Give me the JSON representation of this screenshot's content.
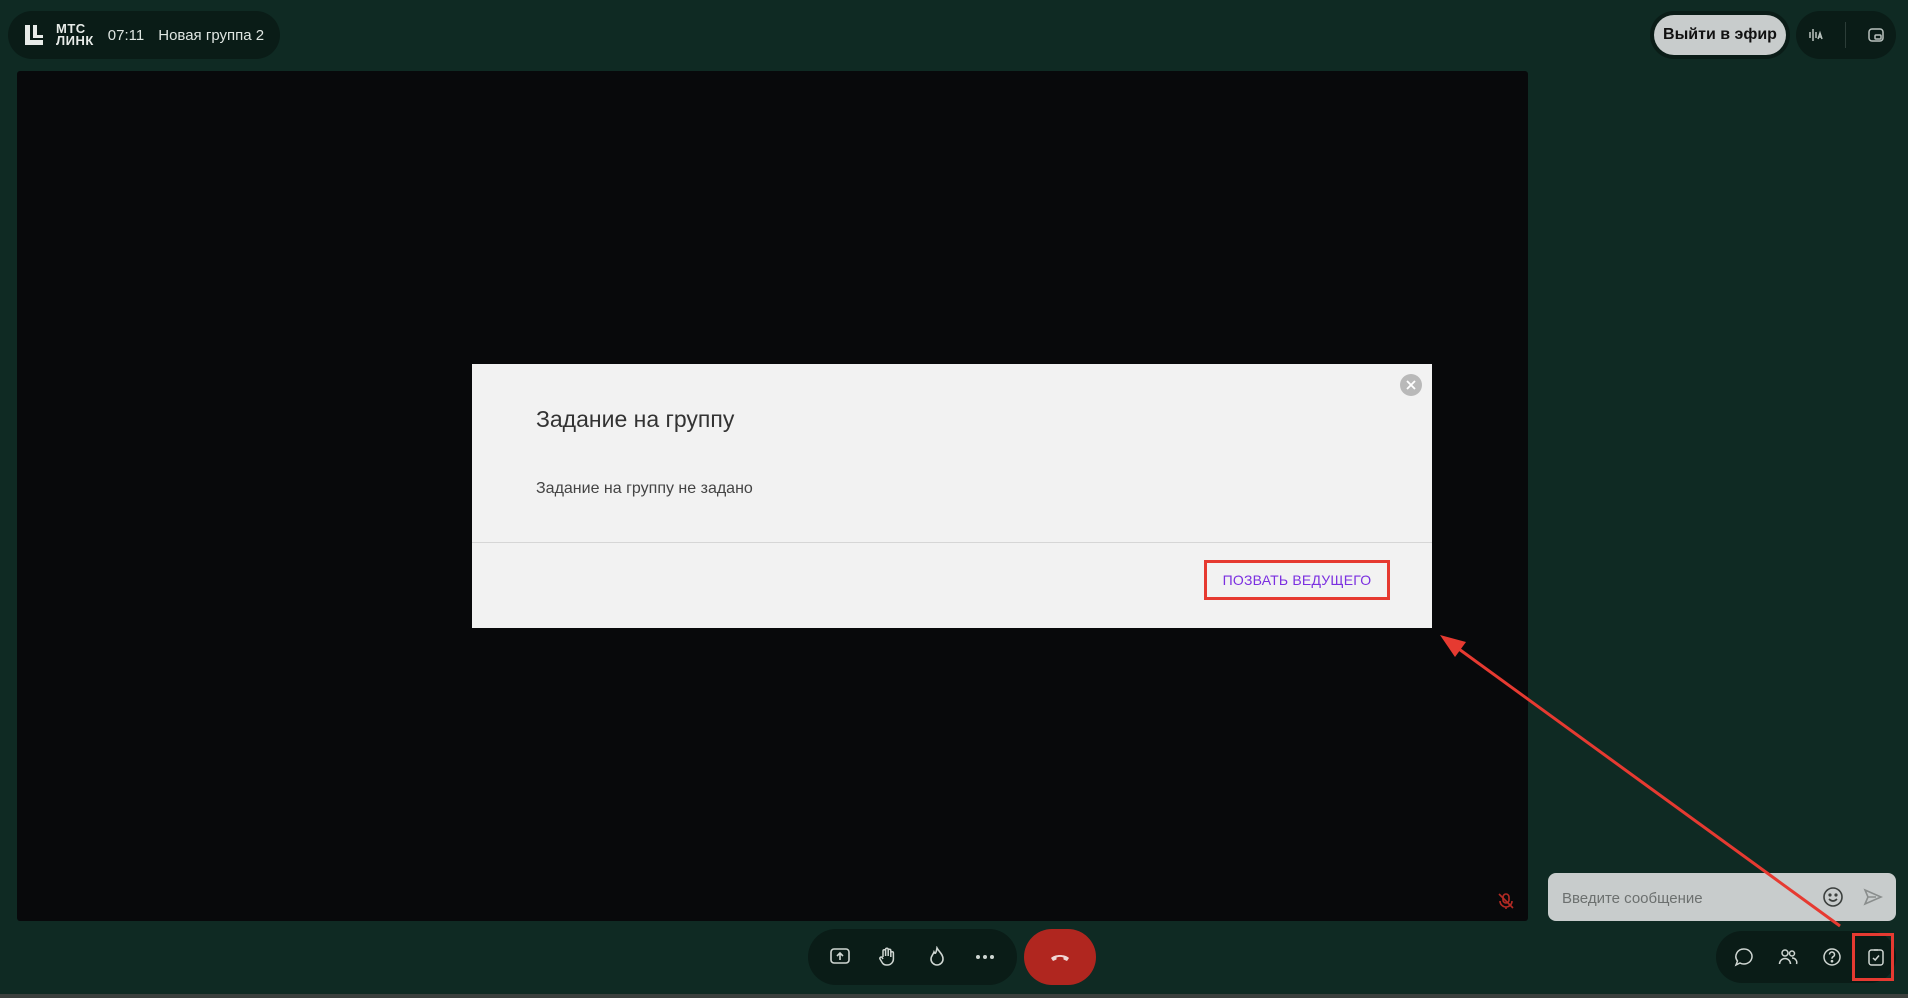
{
  "header": {
    "logo_line1": "МТС",
    "logo_line2": "ЛИНК",
    "time": "07:11",
    "group_name": "Новая группа 2",
    "go_live_label": "Выйти в эфир"
  },
  "modal": {
    "title": "Задание на группу",
    "message": "Задание на группу не задано",
    "call_host_label": "ПОЗВАТЬ ВЕДУЩЕГО"
  },
  "chat": {
    "placeholder": "Введите сообщение"
  },
  "icons": {
    "top_right": [
      "voice-settings-icon",
      "picture-in-picture-icon"
    ],
    "bottom": [
      "screen-share-icon",
      "raise-hand-icon",
      "reaction-icon",
      "more-icon",
      "hang-up-icon"
    ],
    "right_panel": [
      "chat-icon",
      "participants-icon",
      "question-icon",
      "tasks-icon"
    ]
  },
  "colors": {
    "background": "#0f2a23",
    "stage": "#08090b",
    "hangup": "#b0261f",
    "highlight": "#e63a31",
    "accent_text": "#7b2fe0"
  }
}
